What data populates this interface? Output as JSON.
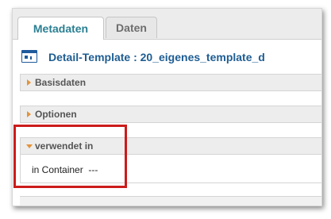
{
  "tabs": [
    {
      "label": "Metadaten",
      "active": true
    },
    {
      "label": "Daten",
      "active": false
    }
  ],
  "header": {
    "title": "Detail-Template : 20_eigenes_template_d",
    "icon": "detail-form-icon"
  },
  "sections": [
    {
      "label": "Basisdaten",
      "expanded": false
    },
    {
      "label": "Optionen",
      "expanded": false
    },
    {
      "label": "verwendet in",
      "expanded": true
    }
  ],
  "usage": {
    "label": "in Container",
    "value": "---"
  },
  "colors": {
    "accent": "#2a7f92",
    "title": "#1e5d92",
    "arrow": "#e3933b",
    "highlight": "#cc1b1b"
  }
}
